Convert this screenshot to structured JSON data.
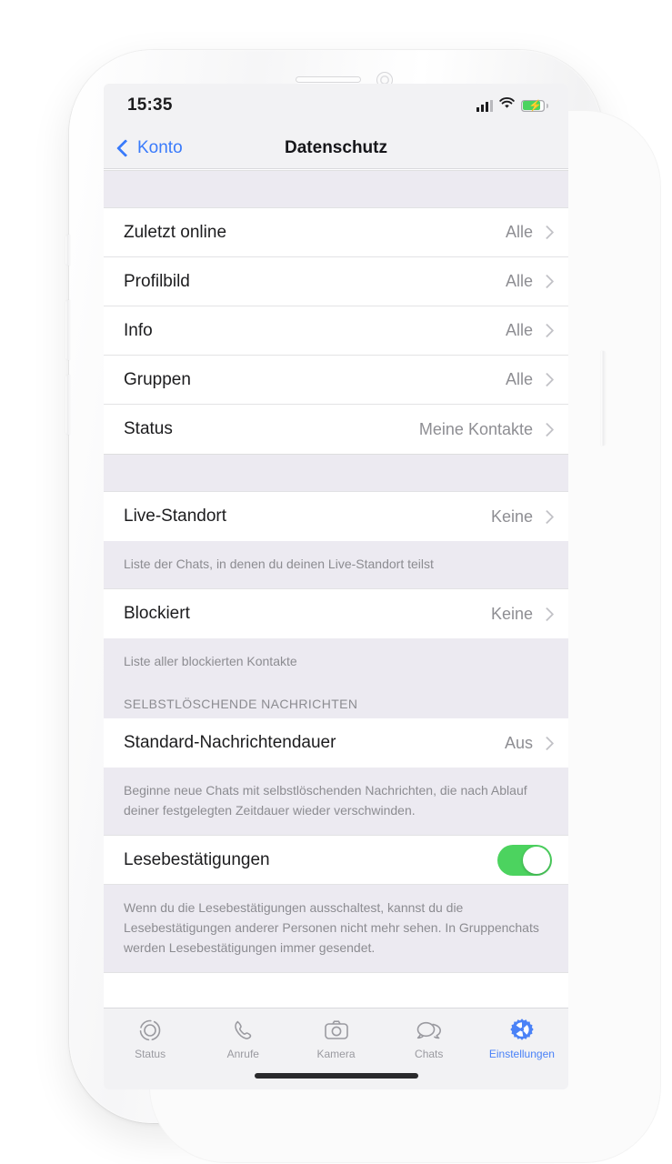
{
  "status_bar": {
    "time": "15:35",
    "signal_icon": "cellular-signal-icon",
    "wifi_icon": "wifi-icon",
    "battery_icon": "battery-charging-icon"
  },
  "nav": {
    "back_label": "Konto",
    "back_icon": "chevron-left-icon",
    "title": "Datenschutz"
  },
  "sections": [
    {
      "rows": [
        {
          "label": "Zuletzt online",
          "value": "Alle"
        },
        {
          "label": "Profilbild",
          "value": "Alle"
        },
        {
          "label": "Info",
          "value": "Alle"
        },
        {
          "label": "Gruppen",
          "value": "Alle"
        },
        {
          "label": "Status",
          "value": "Meine Kontakte"
        }
      ]
    }
  ],
  "live_location": {
    "label": "Live-Standort",
    "value": "Keine"
  },
  "live_location_footer": "Liste der Chats, in denen du deinen Live-Standort teilst",
  "blocked": {
    "label": "Blockiert",
    "value": "Keine"
  },
  "blocked_footer": "Liste aller blockierten Kontakte",
  "disappearing_header": "SELBSTLÖSCHENDE NACHRICHTEN",
  "default_duration": {
    "label": "Standard-Nachrichtendauer",
    "value": "Aus"
  },
  "default_duration_footer": "Beginne neue Chats mit selbstlöschenden Nachrichten, die nach Ablauf deiner festgelegten Zeitdauer wieder verschwinden.",
  "read_receipts": {
    "label": "Lesebestätigungen",
    "enabled": "true"
  },
  "read_receipts_footer": "Wenn du die Lesebestätigungen ausschaltest, kannst du die Lesebestätigungen anderer Personen nicht mehr sehen. In Gruppenchats werden Lesebestätigungen immer gesendet.",
  "tabs": [
    {
      "label": "Status",
      "icon": "status-ring-icon",
      "active": "false"
    },
    {
      "label": "Anrufe",
      "icon": "phone-icon",
      "active": "false"
    },
    {
      "label": "Kamera",
      "icon": "camera-icon",
      "active": "false"
    },
    {
      "label": "Chats",
      "icon": "chat-bubbles-icon",
      "active": "false"
    },
    {
      "label": "Einstellungen",
      "icon": "gear-icon",
      "active": "true"
    }
  ],
  "colors": {
    "accent_blue": "#3a7bfb",
    "toggle_green": "#4cd35f",
    "group_background": "#eceaf1",
    "value_gray": "#8e8e93"
  }
}
